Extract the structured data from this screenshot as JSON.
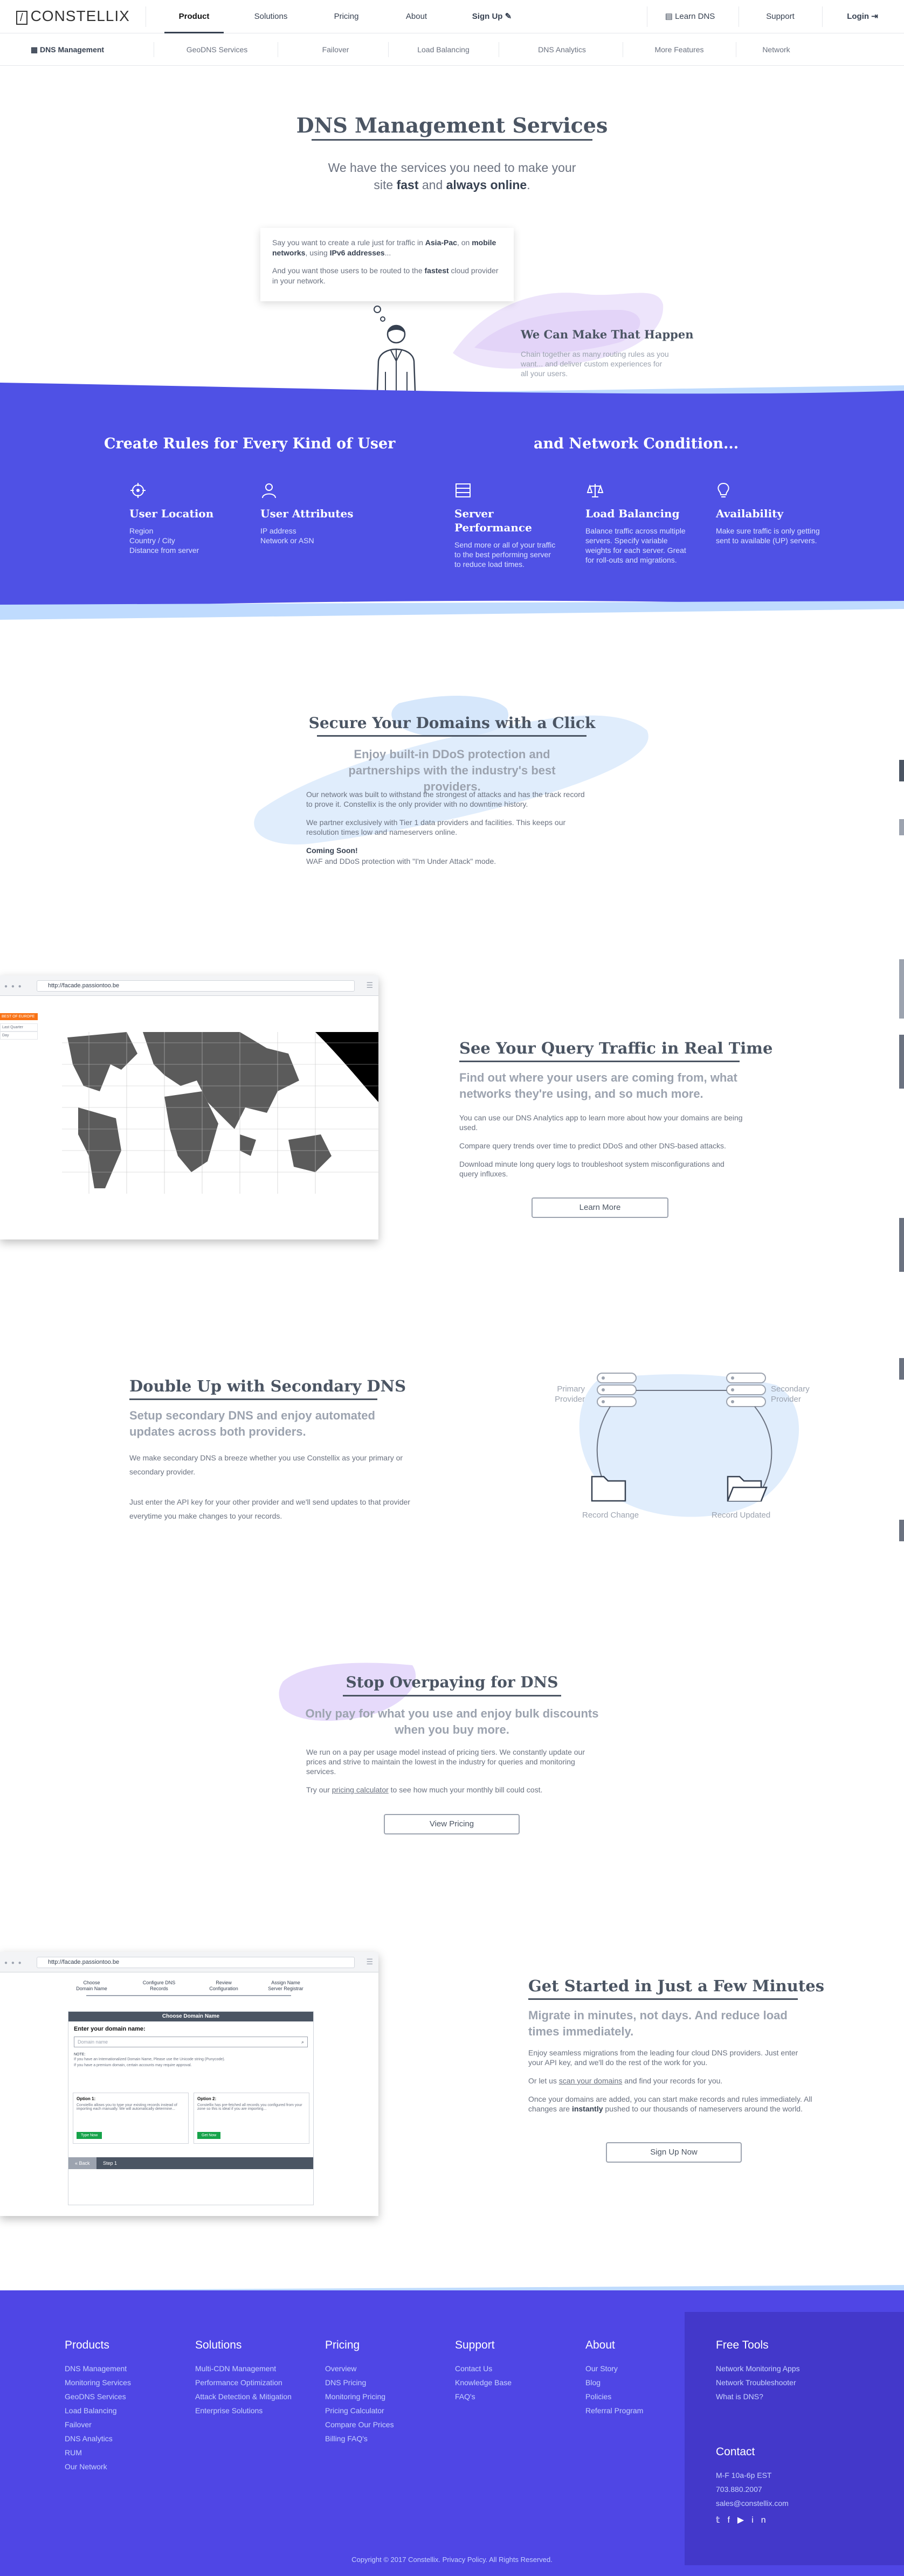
{
  "header": {
    "logo": "CONSTELLIX",
    "nav": [
      {
        "label": "Product"
      },
      {
        "label": "Solutions"
      },
      {
        "label": "Pricing"
      },
      {
        "label": "About"
      },
      {
        "label": "Sign Up"
      }
    ],
    "right": [
      {
        "label": "Learn DNS"
      },
      {
        "label": "Support"
      },
      {
        "label": "Login"
      }
    ]
  },
  "subnav": [
    {
      "label": "DNS Management"
    },
    {
      "label": "GeoDNS Services"
    },
    {
      "label": "Failover"
    },
    {
      "label": "Load Balancing"
    },
    {
      "label": "DNS Analytics"
    },
    {
      "label": "More Features"
    },
    {
      "label": "Network"
    }
  ],
  "hero": {
    "title": "DNS Management Services",
    "sub_line1": "We have the services you need to make your",
    "sub_pre": "site ",
    "sub_fast": "fast",
    "sub_and": " and ",
    "sub_always": "always online",
    "sub_end": ".",
    "bubble1_a": "Say you want to create a rule just for traffic in ",
    "bubble1_b": "Asia-Pac",
    "bubble1_c": ", on ",
    "bubble1_d": "mobile networks",
    "bubble1_e": ", using ",
    "bubble1_f": "IPv6 addresses",
    "bubble1_g": "...",
    "bubble2_a": "And you want those users to be routed to the ",
    "bubble2_b": "fastest",
    "bubble2_c": " cloud provider in your network.",
    "make_title": "We Can Make That Happen",
    "make_text": "Chain together as many routing rules as you want... and deliver custom experiences for all your users."
  },
  "rules": {
    "title_left": "Create Rules for Every Kind of User",
    "title_right": "and Network Condition...",
    "features": [
      {
        "icon": "location-target-icon",
        "title": "User Location",
        "text": "Region\nCountry / City\nDistance from server"
      },
      {
        "icon": "users-icon",
        "title": "User Attributes",
        "text": "IP address\nNetwork or ASN"
      },
      {
        "icon": "server-icon",
        "title": "Server Performance",
        "text": "Send more or all of your traffic to the best performing server to reduce load times."
      },
      {
        "icon": "scale-icon",
        "title": "Load Balancing",
        "text": "Balance traffic across multiple servers. Specify variable weights for each server. Great for roll-outs and migrations."
      },
      {
        "icon": "lightbulb-icon",
        "title": "Availability",
        "text": "Make sure traffic is only getting sent to available (UP) servers."
      }
    ]
  },
  "secure": {
    "title": "Secure Your Domains with a Click",
    "sub": "Enjoy built-in DDoS protection and partnerships with the industry's best providers.",
    "p1": "Our network was built to withstand the strongest of attacks and has the track record to prove it. Constellix is the only provider with no downtime history.",
    "p2": "We partner exclusively with Tier 1 data providers and facilities. This keeps our resolution times low and nameservers online.",
    "soon_title": "Coming Soon!",
    "soon_text": "WAF and DDoS protection with \"I'm Under Attack\" mode."
  },
  "browser": {
    "url": "http://facade.passiontoo.be"
  },
  "analytics": {
    "side_label1": "BEST OF EUROPE",
    "side_label2": "Last Quarter",
    "side_label3": "Day",
    "title": "See Your Query Traffic in Real Time",
    "sub": "Find out where your users are coming from, what networks they're using, and so much more.",
    "p1": "You can use our DNS Analytics app to learn more about how your domains are being used.",
    "p2": "Compare query trends over time to predict DDoS and other DNS-based attacks.",
    "p3": "Download minute long query logs to troubleshoot system misconfigurations and query influxes.",
    "button": "Learn More"
  },
  "secondary": {
    "title": "Double Up with Secondary DNS",
    "sub": "Setup secondary DNS and enjoy automated updates across both providers.",
    "p1": "We make secondary DNS a breeze whether you use Constellix as your primary or secondary provider.",
    "p2": "Just enter the API key for your other provider and we'll send updates to that provider everytime you make changes to your records.",
    "primary_label": "Primary Provider",
    "secondary_label": "Secondary Provider",
    "record_change": "Record Change",
    "record_updated": "Record Updated"
  },
  "pricing": {
    "title": "Stop Overpaying for DNS",
    "sub": "Only pay for what you use and enjoy bulk discounts when you buy more.",
    "p1": "We run on a pay per usage model instead of pricing tiers. We constantly update our prices and strive to maintain the lowest in the industry for queries and monitoring services.",
    "p2_a": "Try our ",
    "p2_link": "pricing calculator",
    "p2_b": " to see how much your monthly bill could cost.",
    "button": "View Pricing"
  },
  "wizard": {
    "steps": [
      "Choose Domain Name",
      "Configure DNS Records",
      "Review Configuration",
      "Assign Name Server Registrar"
    ],
    "panel_title": "Choose Domain Name",
    "enter_label": "Enter your domain name:",
    "placeholder": "Domain name",
    "note_title": "NOTE:",
    "note1": "If you have an Internationalized Domain Name, Please use the Unicode string (Punycode).",
    "note2": "If you have a premium domain, certain accounts may require approval.",
    "opt1_title": "Option 1:",
    "opt1_text": "Constellix allows you to type your existing records instead of importing each manually. We will automatically determine...",
    "opt1_btn": "Type Now",
    "opt2_title": "Option 2:",
    "opt2_text": "Constellix has pre-fetched all records you configured from your zone so this is ideal if you are importing...",
    "opt2_btn": "Get Now",
    "back": "« Back",
    "step": "Step 1"
  },
  "getstarted": {
    "title": "Get Started in Just a Few Minutes",
    "sub": "Migrate in minutes, not days. And reduce load times immediately.",
    "p1": "Enjoy seamless migrations from the leading four cloud DNS providers. Just enter your API key, and we'll do the rest of the work for you.",
    "p2_a": "Or let us ",
    "p2_link": "scan your domains",
    "p2_b": " and find your records for you.",
    "p3_a": "Once your domains are added, you can start make records and rules immediately. All changes are ",
    "p3_b": "instantly",
    "p3_c": " pushed to our thousands of nameservers around the world.",
    "button": "Sign Up Now"
  },
  "footer": {
    "cols": [
      {
        "title": "Products",
        "items": [
          "DNS Management",
          "Monitoring Services",
          "GeoDNS Services",
          "Load Balancing",
          "Failover",
          "DNS Analytics",
          "RUM",
          "Our Network"
        ]
      },
      {
        "title": "Solutions",
        "items": [
          "Multi-CDN Management",
          "Performance Optimization",
          "Attack Detection & Mitigation",
          "Enterprise Solutions"
        ]
      },
      {
        "title": "Pricing",
        "items": [
          "Overview",
          "DNS Pricing",
          "Monitoring Pricing",
          "Pricing Calculator",
          "Compare Our Prices",
          "Billing FAQ's"
        ]
      },
      {
        "title": "Support",
        "items": [
          "Contact Us",
          "Knowledge Base",
          "FAQ's"
        ]
      },
      {
        "title": "About",
        "items": [
          "Our Story",
          "Blog",
          "Policies",
          "Referral Program"
        ]
      }
    ],
    "tools": {
      "title": "Free Tools",
      "items": [
        "Network Monitoring Apps",
        "Network Troubleshooter",
        "What is DNS?"
      ]
    },
    "contact": {
      "title": "Contact",
      "items": [
        "M-F 10a-6p EST",
        "703.880.2007",
        "sales@constellix.com"
      ]
    },
    "social": [
      "twitter-icon",
      "facebook-icon",
      "youtube-icon",
      "linkedin-icon"
    ],
    "copyright": "Copyright © 2017 Constellix. Privacy Policy. All Rights Reserved."
  },
  "colors": {
    "accent": "#4f46e5",
    "dark": "#4b5563",
    "muted": "#9ca3af",
    "light_blue": "#bfdbfe",
    "lavender": "#e9d5ff"
  }
}
